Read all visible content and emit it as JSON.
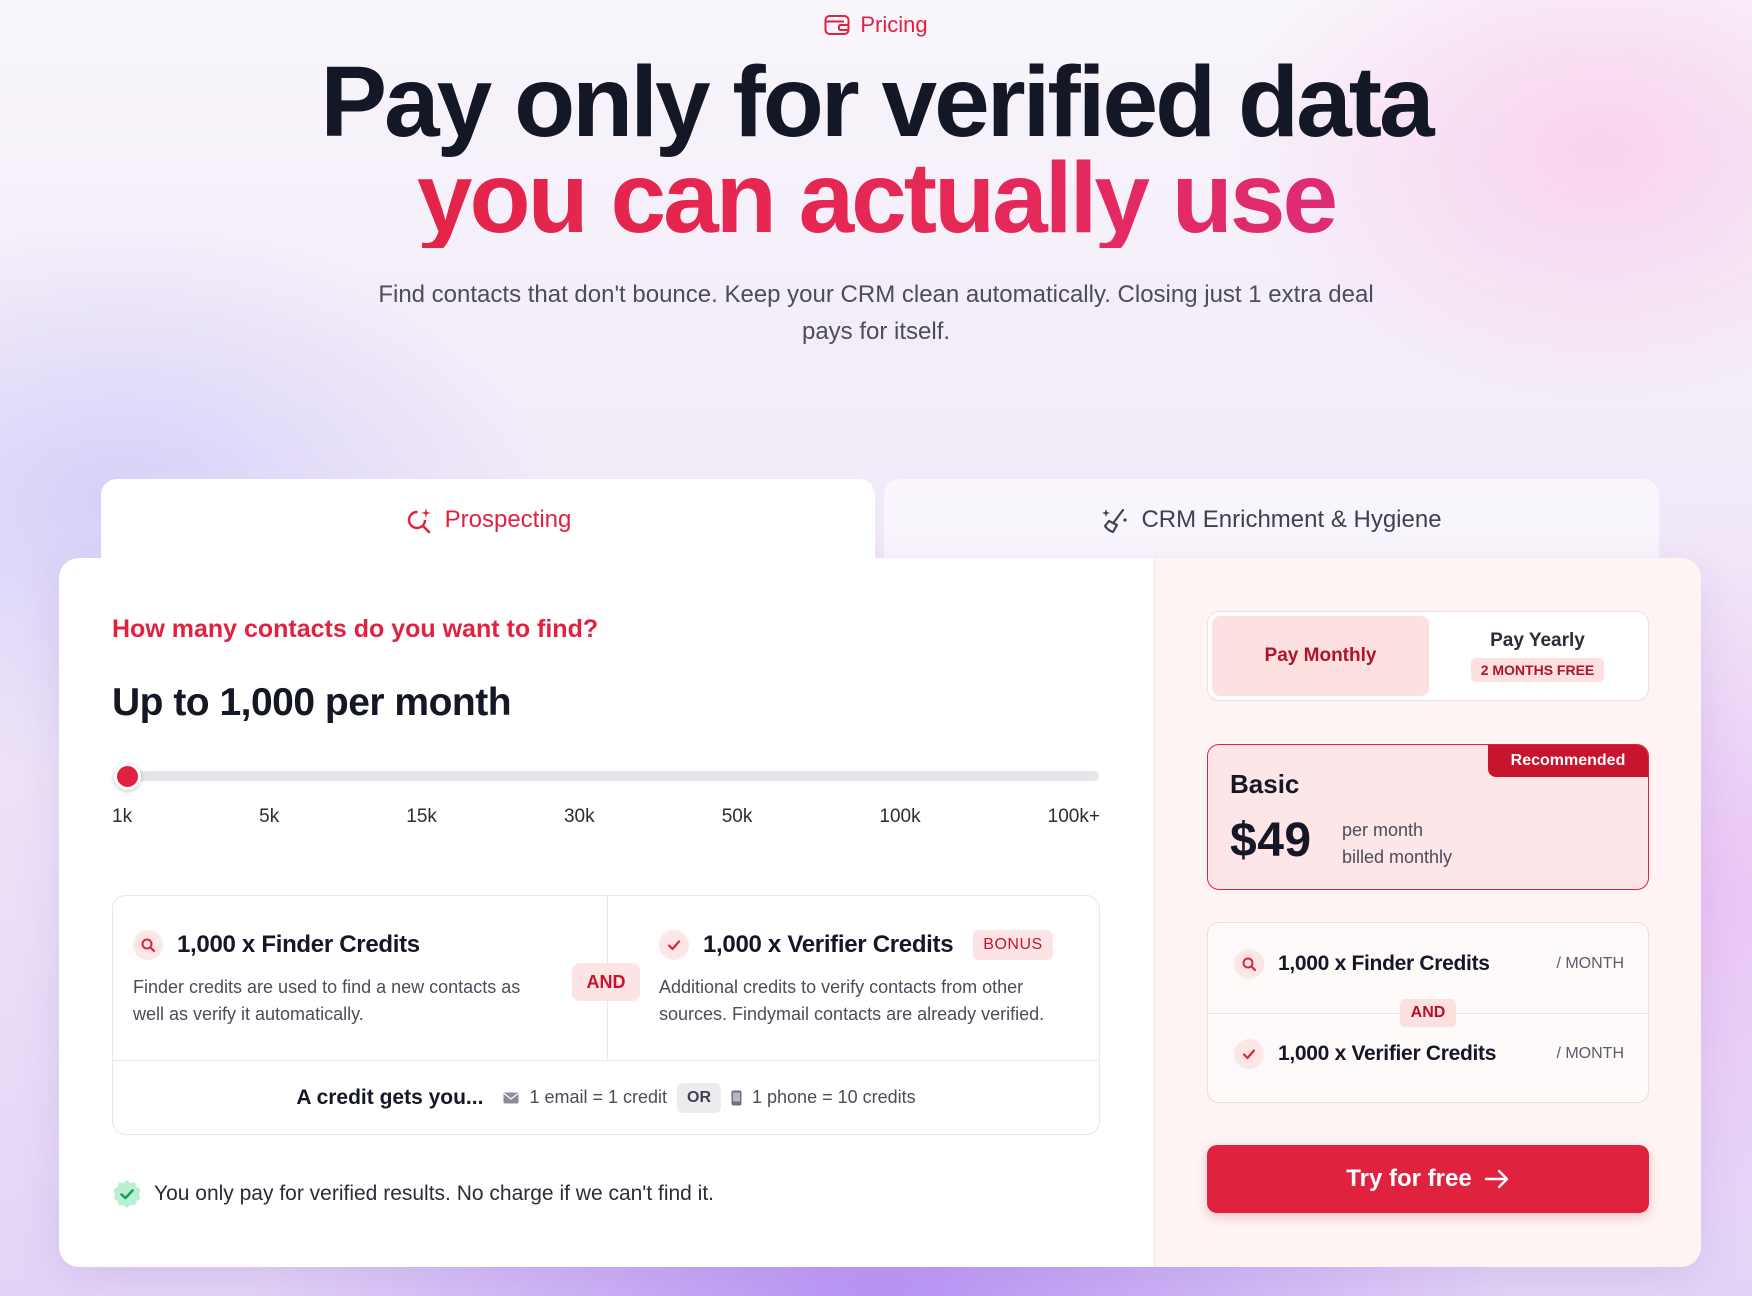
{
  "header": {
    "eyebrow": "Pricing",
    "title_line1": "Pay only for verified data",
    "title_line2": "you can actually use",
    "subtitle": "Find contacts that don't bounce. Keep your CRM clean automatically. Closing just 1 extra deal pays for itself."
  },
  "tabs": [
    {
      "label": "Prospecting",
      "active": true,
      "icon": "search-sparkle-icon"
    },
    {
      "label": "CRM Enrichment & Hygiene",
      "active": false,
      "icon": "magic-broom-icon"
    }
  ],
  "calculator": {
    "question": "How many contacts do you want to find?",
    "selected_label": "Up to 1,000 per month",
    "slider_value_index": 0,
    "slider_ticks": [
      "1k",
      "5k",
      "15k",
      "30k",
      "50k",
      "100k",
      "100k+"
    ]
  },
  "credits": {
    "finder_title": "1,000 x Finder Credits",
    "finder_desc": "Finder credits are used to find a new contacts as well as verify it automatically.",
    "and_label": "AND",
    "verifier_title": "1,000 x Verifier Credits",
    "bonus_label": "BONUS",
    "verifier_desc": "Additional credits to verify contacts from other sources. Findymail contacts are already verified.",
    "gets_label": "A credit gets you...",
    "email_rate": "1 email = 1 credit",
    "or_label": "OR",
    "phone_rate": "1 phone = 10 credits"
  },
  "guarantee": "You only pay for verified results. No charge if we can't find it.",
  "billing": {
    "monthly_label": "Pay Monthly",
    "yearly_label": "Pay Yearly",
    "yearly_badge": "2 MONTHS FREE",
    "selected": "monthly"
  },
  "plan": {
    "badge": "Recommended",
    "name": "Basic",
    "price": "$49",
    "period_line1": "per month",
    "period_line2": "billed monthly"
  },
  "included": {
    "finder": "1,000 x Finder Credits",
    "verifier": "1,000 x Verifier Credits",
    "unit": "/ MONTH",
    "and_label": "AND"
  },
  "cta": {
    "label": "Try for free"
  },
  "colors": {
    "accent": "#e0223f",
    "accent_dark": "#c8142e",
    "accent_soft": "#fde4e4",
    "success": "#2bb673"
  }
}
